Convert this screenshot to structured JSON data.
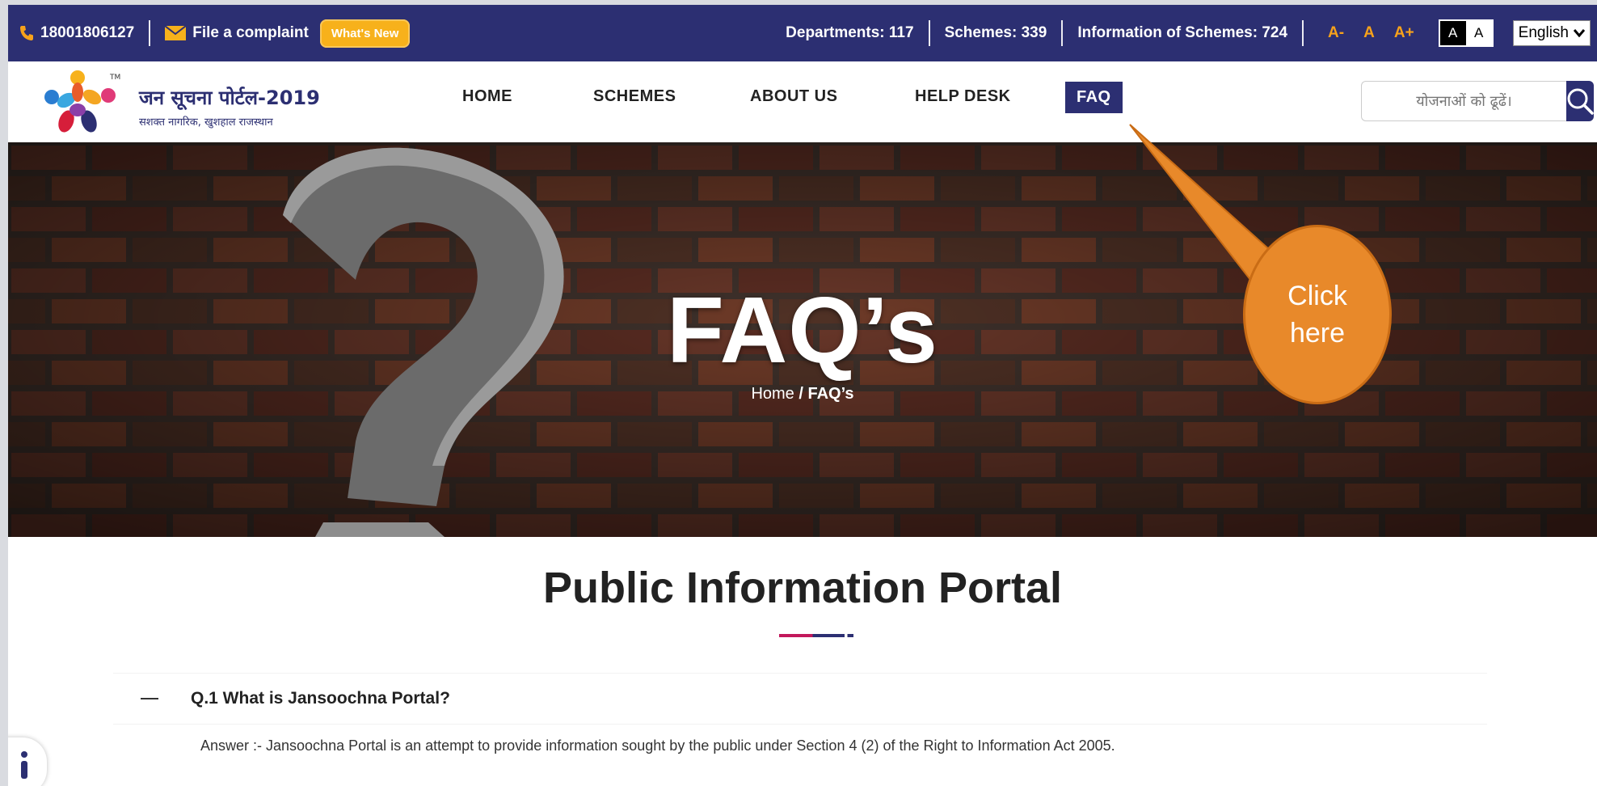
{
  "topbar": {
    "phone": "18001806127",
    "complaint": "File a complaint",
    "whats_new": "What's New",
    "departments": "Departments: 117",
    "schemes": "Schemes: 339",
    "info_schemes": "Information of Schemes: 724",
    "font_decrease": "A-",
    "font_normal": "A",
    "font_increase": "A+",
    "contrast_dark": "A",
    "contrast_light": "A",
    "language": "English"
  },
  "logo": {
    "title": "जन सूचना पोर्टल-2019",
    "subtitle": "सशक्त नागरिक, खुशहाल राजस्थान",
    "tm": "TM"
  },
  "nav": {
    "home": "HOME",
    "schemes": "SCHEMES",
    "about": "ABOUT US",
    "helpdesk": "HELP DESK",
    "faq": "FAQ"
  },
  "search": {
    "placeholder": "योजनाओं को ढूढें।"
  },
  "hero": {
    "title": "FAQ’s",
    "breadcrumb_home": "Home",
    "breadcrumb_current": "/ FAQ’s"
  },
  "callout": {
    "line1": "Click",
    "line2": "here"
  },
  "content": {
    "title": "Public Information Portal",
    "question": "Q.1 What is Jansoochna Portal?",
    "answer": "Answer :- Jansoochna Portal is an attempt to provide information sought by the public under Section 4 (2) of the Right to Information Act 2005."
  },
  "colors": {
    "primary": "#2c2f72",
    "accent": "#f7b11b",
    "callout": "#e8892a"
  }
}
